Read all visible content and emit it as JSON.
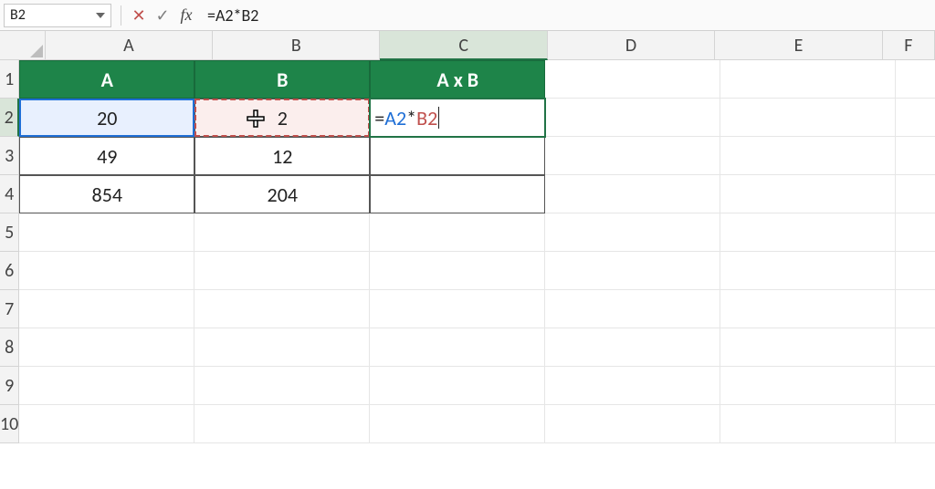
{
  "formula_bar": {
    "name_box": "B2",
    "cancel_symbol": "✕",
    "accept_symbol": "✓",
    "fx_symbol": "fx",
    "formula_text": "=A2*B2"
  },
  "columns": [
    "A",
    "B",
    "C",
    "D",
    "E",
    "F"
  ],
  "rows": [
    "1",
    "2",
    "3",
    "4",
    "5",
    "6",
    "7",
    "8",
    "9",
    "10"
  ],
  "editing_cell": {
    "eq": "=",
    "refA": "A2",
    "op": "*",
    "refB": "B2"
  },
  "sheet": {
    "r1": {
      "A": "A",
      "B": "B",
      "C": "A x B"
    },
    "r2": {
      "A": "20",
      "B": "2"
    },
    "r3": {
      "A": "49",
      "B": "12"
    },
    "r4": {
      "A": "854",
      "B": "204"
    }
  }
}
